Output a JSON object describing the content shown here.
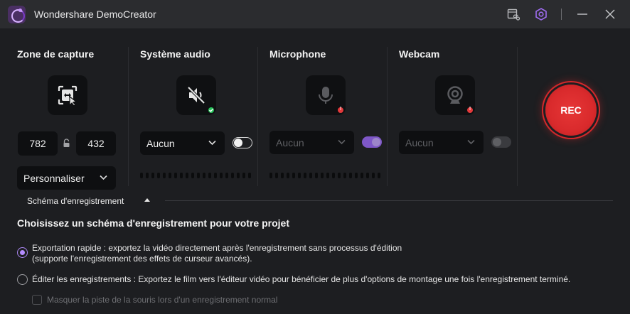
{
  "titlebar": {
    "app_title": "Wondershare DemoCreator",
    "icons": [
      "screen-recorder-cut-icon",
      "settings-hex-icon",
      "minimize-icon",
      "close-icon"
    ]
  },
  "sections": {
    "capture": {
      "title": "Zone de capture",
      "icon": "capture-area-icon",
      "width": "782",
      "height": "432",
      "preset_value": "Personnaliser"
    },
    "system_audio": {
      "title": "Système audio",
      "icon": "speaker-muted-icon",
      "status": "ok",
      "device_value": "Aucun",
      "toggle_on": false
    },
    "microphone": {
      "title": "Microphone",
      "icon": "microphone-icon",
      "status": "error",
      "device_value": "Aucun",
      "disabled": true,
      "toggle_on": true
    },
    "webcam": {
      "title": "Webcam",
      "icon": "webcam-icon",
      "status": "error",
      "device_value": "Aucun",
      "disabled": true,
      "toggle_on": false
    }
  },
  "rec_button": {
    "label": "REC",
    "color": "#e03233"
  },
  "schema": {
    "tab_label": "Schéma d'enregistrement",
    "heading": "Choisissez un schéma d'enregistrement pour votre projet",
    "options": [
      {
        "selected": true,
        "line1": "Exportation rapide : exportez la vidéo directement après l'enregistrement sans processus d'édition",
        "line2": "(supporte l'enregistrement des effets de curseur avancés)."
      },
      {
        "selected": false,
        "line1": "Éditer les enregistrements : Exportez le film vers l'éditeur vidéo pour bénéficier de plus d'options de montage une fois l'enregistrement terminé."
      }
    ],
    "checkbox_label": "Masquer la piste de la souris lors d'un enregistrement normal",
    "checkbox_checked": false
  },
  "colors": {
    "accent": "#a985f0",
    "background": "#1d1e21",
    "titlebar": "#2b2c2f",
    "ok": "#27c25a",
    "error": "#e3393b"
  }
}
